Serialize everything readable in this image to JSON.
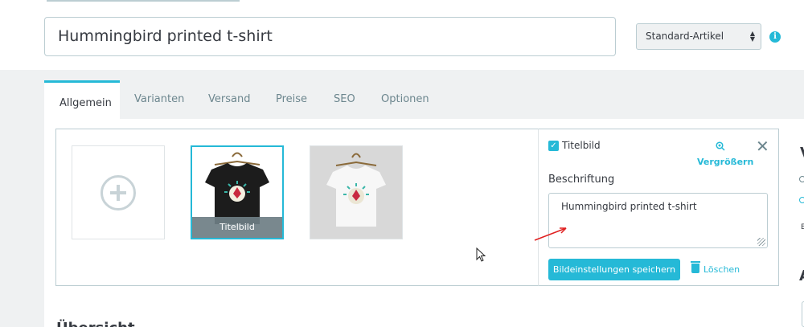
{
  "product": {
    "name": "Hummingbird printed t-shirt",
    "type_selected": "Standard-Artikel"
  },
  "tabs": [
    {
      "label": "Allgemein",
      "active": true
    },
    {
      "label": "Varianten"
    },
    {
      "label": "Versand"
    },
    {
      "label": "Preise"
    },
    {
      "label": "SEO"
    },
    {
      "label": "Optionen"
    }
  ],
  "images": {
    "cover_label": "Titelbild",
    "items": [
      {
        "shirt_color": "black",
        "is_cover": true
      },
      {
        "shirt_color": "white",
        "is_cover": false
      }
    ]
  },
  "image_settings": {
    "cover_checkbox_label": "Titelbild",
    "cover_checked": true,
    "zoom_label": "Vergrößern",
    "caption_label": "Beschriftung",
    "caption_value": "Hummingbird printed t-shirt",
    "save_label": "Bildeinstellungen speichern",
    "delete_label": "Löschen"
  },
  "icons": {
    "info": "info-icon",
    "zoom": "zoom-in-icon",
    "close": "close-icon",
    "trash": "trash-icon",
    "add": "plus-circle-icon"
  },
  "colors": {
    "accent": "#25b9d7",
    "text": "#363a41",
    "muted": "#6c868e",
    "border": "#bbcdd2"
  },
  "partial": {
    "bottom_heading": "Übersicht",
    "right_fragment_1": "V",
    "right_fragment_4": "E",
    "right_fragment_5": "A"
  }
}
